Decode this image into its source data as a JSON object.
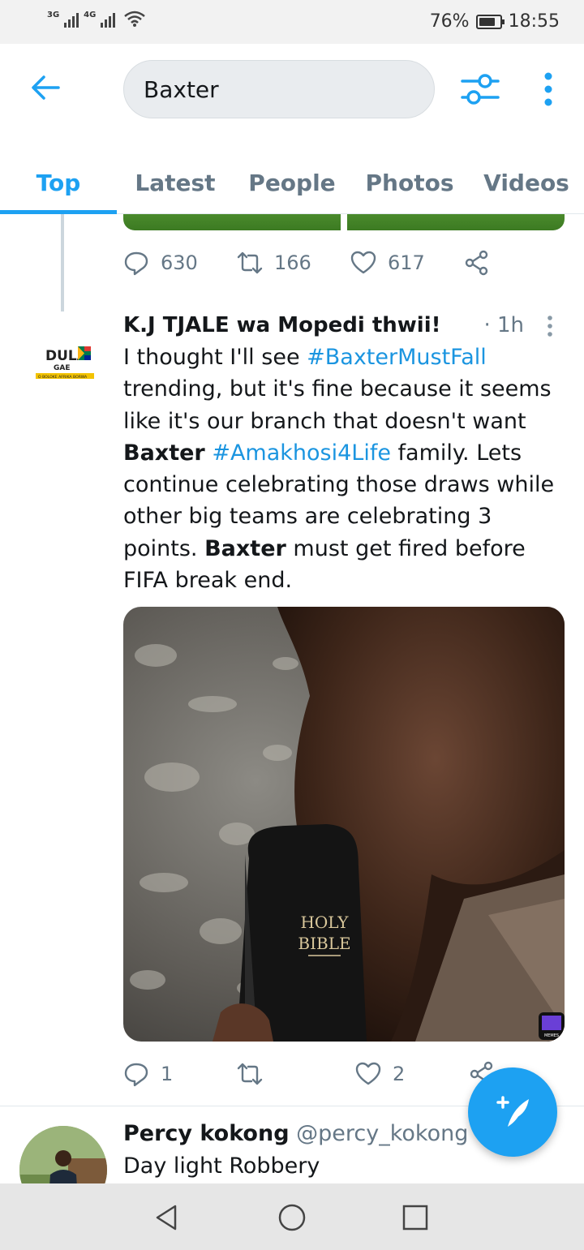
{
  "status_bar": {
    "network_1": "3G",
    "network_2": "4G",
    "battery": "76%",
    "time": "18:55"
  },
  "search": {
    "value": "Baxter"
  },
  "tabs": [
    {
      "label": "Top",
      "active": true
    },
    {
      "label": "Latest",
      "active": false
    },
    {
      "label": "People",
      "active": false
    },
    {
      "label": "Photos",
      "active": false
    },
    {
      "label": "Videos",
      "active": false
    }
  ],
  "tweet_prev": {
    "replies": "630",
    "retweets": "166",
    "likes": "617"
  },
  "tweet_main": {
    "author": "K.J TJALE wa Mopedi thwii!",
    "time": "· 1h",
    "avatar_text": {
      "line1": "DULA",
      "line2": "GAE",
      "line3": "O BOLOKE AFRIKA BORWA"
    },
    "body": {
      "p1": "I thought I'll see ",
      "hashtag1": "#BaxterMustFall",
      "p2": " trending, but it's fine because it seems like it's our branch that doesn't want ",
      "bold1": "Baxter",
      "p3": " ",
      "hashtag2": "#Amakhosi4Life",
      "p4": " family. Lets continue celebrating those draws while other big teams are celebrating 3 points. ",
      "bold2": "Baxter",
      "p5": " must get fired before FIFA break end."
    },
    "photo_text": {
      "line1": "HOLY",
      "line2": "BIBLE",
      "watermark": "MEMES"
    },
    "replies": "1",
    "retweets": "",
    "likes": "2"
  },
  "tweet_next": {
    "author": "Percy kokong",
    "handle": "@percy_kokong",
    "separator": " ·",
    "body": "Day light Robbery"
  },
  "colors": {
    "accent": "#1da1f2",
    "hashtag": "#1b95e0",
    "muted": "#657786"
  }
}
